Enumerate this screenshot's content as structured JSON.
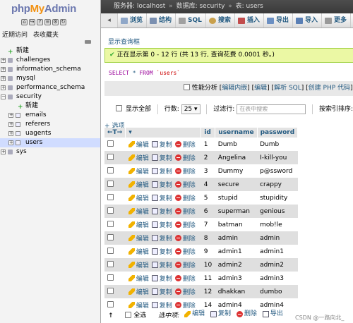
{
  "nav": {
    "logo": {
      "php": "php",
      "my": "My",
      "admin": "Admin"
    },
    "tab_recent": "近期访问",
    "tab_favorites": "表收藏夹",
    "tree": {
      "new": "新建",
      "databases": [
        "challenges",
        "information_schema",
        "mysql",
        "performance_schema"
      ],
      "security": "security",
      "security_new": "新建",
      "tables": [
        "emails",
        "referers",
        "uagents",
        "users"
      ],
      "sys": "sys"
    }
  },
  "topbar": {
    "server": "服务器: localhost",
    "database": "数据库: security",
    "table": "表: users"
  },
  "tabs": [
    "浏览",
    "结构",
    "SQL",
    "搜索",
    "插入",
    "导出",
    "导入",
    "更多"
  ],
  "content": {
    "show_query_box": "显示查询框",
    "success_message": "正在显示第 0 - 12 行 (共 13 行, 查询花费 0.0001 秒。)",
    "sql": {
      "select": "SELECT",
      "star": " * ",
      "from": "FROM",
      "table": "`users`"
    },
    "sql_options": {
      "profiling": "性能分析",
      "inline_edit": "编辑内嵌",
      "edit": "编辑",
      "explain": "解析 SQL",
      "create_php": "创建 PHP 代码"
    },
    "navbar": {
      "show_all": "显示全部",
      "rows_label": "行数:",
      "rows_value": "25",
      "filter_label": "过滤行:",
      "filter_placeholder": "在表中搜索",
      "sort_label": "按索引排序:"
    },
    "options_link": "+ 选项",
    "columns": [
      "id",
      "username",
      "password"
    ],
    "action_labels": {
      "edit": "编辑",
      "copy": "复制",
      "delete": "删除"
    },
    "rows": [
      {
        "id": "1",
        "username": "Dumb",
        "password": "Dumb"
      },
      {
        "id": "2",
        "username": "Angelina",
        "password": "I-kill-you"
      },
      {
        "id": "3",
        "username": "Dummy",
        "password": "p@ssword"
      },
      {
        "id": "4",
        "username": "secure",
        "password": "crappy"
      },
      {
        "id": "5",
        "username": "stupid",
        "password": "stupidity"
      },
      {
        "id": "6",
        "username": "superman",
        "password": "genious"
      },
      {
        "id": "7",
        "username": "batman",
        "password": "mob!le"
      },
      {
        "id": "8",
        "username": "admin",
        "password": "admin"
      },
      {
        "id": "9",
        "username": "admin1",
        "password": "admin1"
      },
      {
        "id": "10",
        "username": "admin2",
        "password": "admin2"
      },
      {
        "id": "11",
        "username": "admin3",
        "password": "admin3"
      },
      {
        "id": "12",
        "username": "dhakkan",
        "password": "dumbo"
      },
      {
        "id": "14",
        "username": "admin4",
        "password": "admin4"
      }
    ],
    "bottom": {
      "select_all": "全选",
      "with_selected": "选中项:",
      "edit": "编辑",
      "copy": "复制",
      "delete": "删除",
      "export": "导出"
    }
  },
  "watermark": "CSDN @一路向北_"
}
